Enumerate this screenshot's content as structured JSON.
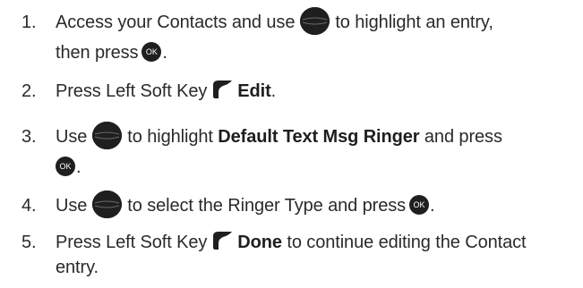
{
  "icons": {
    "navigation_key": "navigation-key-icon",
    "ok_key": "ok-key-icon",
    "left_soft_key": "left-soft-key-icon"
  },
  "icon_colors": {
    "key_fill": "#1f1f1f",
    "key_text": "#ffffff"
  },
  "ok_key_label": "OK",
  "steps": [
    {
      "number": "1.",
      "line1_a": "Access your Contacts and use",
      "line1_b": "to highlight an entry,",
      "line2_a": "then press",
      "line2_b": "."
    },
    {
      "number": "2.",
      "text_a": "Press Left Soft Key",
      "bold": "Edit",
      "text_b": "."
    },
    {
      "number": "3.",
      "line1_a": "Use",
      "line1_b": "to highlight",
      "bold": "Default Text Msg Ringer",
      "line1_c": "and press",
      "line2_b": "."
    },
    {
      "number": "4.",
      "text_a": "Use",
      "text_b": "to select the Ringer Type and press",
      "text_c": "."
    },
    {
      "number": "5.",
      "line1_a": "Press Left Soft Key",
      "bold": "Done",
      "line1_b": "to continue editing the Contact",
      "line2": "entry."
    }
  ]
}
